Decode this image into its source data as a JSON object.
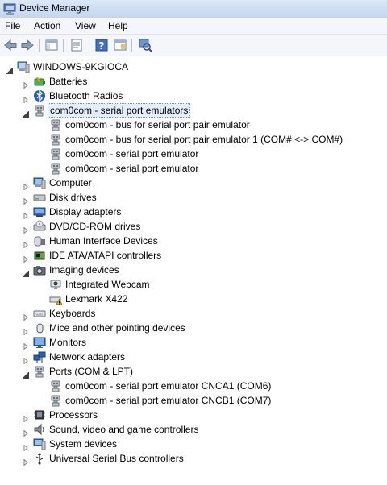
{
  "window": {
    "title": "Device Manager"
  },
  "menu": [
    "File",
    "Action",
    "View",
    "Help"
  ],
  "toolbar": {
    "buttons": [
      "back-icon",
      "forward-icon",
      "show-hide-console-tree-icon",
      "properties-icon",
      "help-icon",
      "action-pane-icon",
      "scan-hardware-changes-icon"
    ]
  },
  "tree": {
    "root": "WINDOWS-9KGIOCA",
    "items": [
      {
        "label": "Batteries",
        "level": 1,
        "expander": "collapsed",
        "icon": "battery-icon"
      },
      {
        "label": "Bluetooth Radios",
        "level": 1,
        "expander": "collapsed",
        "icon": "bluetooth-icon"
      },
      {
        "label": "com0com - serial port emulators",
        "level": 1,
        "expander": "expanded",
        "icon": "serial-port-icon",
        "selected": true
      },
      {
        "label": "com0com - bus for serial port pair emulator",
        "level": 2,
        "icon": "serial-port-icon"
      },
      {
        "label": "com0com - bus for serial port pair emulator 1 (COM# <-> COM#)",
        "level": 2,
        "icon": "serial-port-icon"
      },
      {
        "label": "com0com - serial port emulator",
        "level": 2,
        "icon": "serial-port-icon"
      },
      {
        "label": "com0com - serial port emulator",
        "level": 2,
        "icon": "serial-port-icon"
      },
      {
        "label": "Computer",
        "level": 1,
        "expander": "collapsed",
        "icon": "computer-icon"
      },
      {
        "label": "Disk drives",
        "level": 1,
        "expander": "collapsed",
        "icon": "disk-drive-icon"
      },
      {
        "label": "Display adapters",
        "level": 1,
        "expander": "collapsed",
        "icon": "display-adapter-icon"
      },
      {
        "label": "DVD/CD-ROM drives",
        "level": 1,
        "expander": "collapsed",
        "icon": "dvd-drive-icon"
      },
      {
        "label": "Human Interface Devices",
        "level": 1,
        "expander": "collapsed",
        "icon": "hid-icon"
      },
      {
        "label": "IDE ATA/ATAPI controllers",
        "level": 1,
        "expander": "collapsed",
        "icon": "ide-controller-icon"
      },
      {
        "label": "Imaging devices",
        "level": 1,
        "expander": "expanded",
        "icon": "camera-icon"
      },
      {
        "label": "Integrated Webcam",
        "level": 2,
        "icon": "webcam-icon"
      },
      {
        "label": "Lexmark X422",
        "level": 2,
        "icon": "scanner-warning-icon"
      },
      {
        "label": "Keyboards",
        "level": 1,
        "expander": "collapsed",
        "icon": "keyboard-icon"
      },
      {
        "label": "Mice and other pointing devices",
        "level": 1,
        "expander": "collapsed",
        "icon": "mouse-icon"
      },
      {
        "label": "Monitors",
        "level": 1,
        "expander": "collapsed",
        "icon": "monitor-icon"
      },
      {
        "label": "Network adapters",
        "level": 1,
        "expander": "collapsed",
        "icon": "network-adapter-icon"
      },
      {
        "label": "Ports (COM & LPT)",
        "level": 1,
        "expander": "expanded",
        "icon": "port-icon"
      },
      {
        "label": "com0com - serial port emulator CNCA1 (COM6)",
        "level": 2,
        "icon": "serial-port-icon"
      },
      {
        "label": "com0com - serial port emulator CNCB1 (COM7)",
        "level": 2,
        "icon": "serial-port-icon"
      },
      {
        "label": "Processors",
        "level": 1,
        "expander": "collapsed",
        "icon": "processor-icon"
      },
      {
        "label": "Sound, video and game controllers",
        "level": 1,
        "expander": "collapsed",
        "icon": "sound-icon"
      },
      {
        "label": "System devices",
        "level": 1,
        "expander": "collapsed",
        "icon": "system-device-icon"
      },
      {
        "label": "Universal Serial Bus controllers",
        "level": 1,
        "expander": "collapsed",
        "icon": "usb-icon"
      }
    ]
  },
  "colors": {
    "selection": "#e5eefb",
    "titlebar": "#c3d6ee"
  }
}
